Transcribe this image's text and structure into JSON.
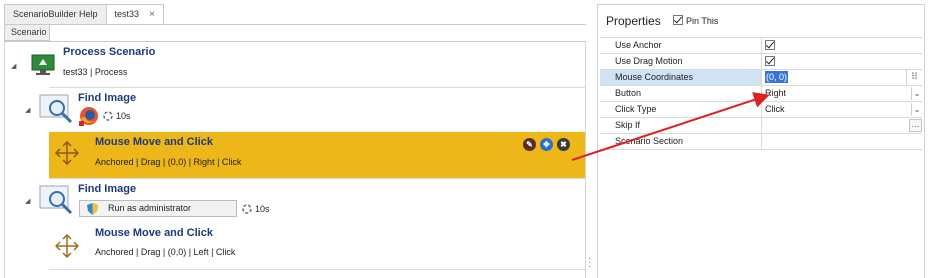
{
  "tabs": [
    {
      "label": "ScenarioBuilder Help"
    },
    {
      "label": "test33",
      "close": "×"
    }
  ],
  "subtab": {
    "label": "Scenario"
  },
  "tree": {
    "process": {
      "title": "Process Scenario",
      "subtitle": "test33 | Process"
    },
    "find1": {
      "title": "Find Image",
      "wait": "10s"
    },
    "move1": {
      "title": "Mouse Move and Click",
      "details": "Anchored | Drag |  (0,0) | Right | Click"
    },
    "find2": {
      "title": "Find Image",
      "button": "Run as administrator",
      "wait": "10s"
    },
    "move2": {
      "title": "Mouse Move and Click",
      "details": "Anchored | Drag |  (0,0) | Left | Click"
    }
  },
  "properties": {
    "title": "Properties",
    "pin_label": "Pin This",
    "rows": [
      {
        "name": "Use Anchor",
        "value": ""
      },
      {
        "name": "Use Drag Motion",
        "value": ""
      },
      {
        "name": "Mouse Coordinates",
        "value": "(0, 0)"
      },
      {
        "name": "Button",
        "value": "Right"
      },
      {
        "name": "Click Type",
        "value": "Click"
      },
      {
        "name": "Skip If",
        "value": ""
      },
      {
        "name": "Scenario Section",
        "value": ""
      }
    ]
  },
  "colors": {
    "highlight": "#edb71a",
    "title_blue": "#1d3a7a",
    "arrow": "#e02020",
    "selection": "#3875d7"
  },
  "icons": [
    "desktop-process-icon",
    "find-image-icon",
    "firefox-icon",
    "move-cross-icon",
    "edit-icon",
    "target-icon",
    "tools-icon",
    "shield-icon",
    "spinner-icon",
    "chevron-down-icon",
    "ellipsis-icon",
    "crosshair-icon"
  ]
}
